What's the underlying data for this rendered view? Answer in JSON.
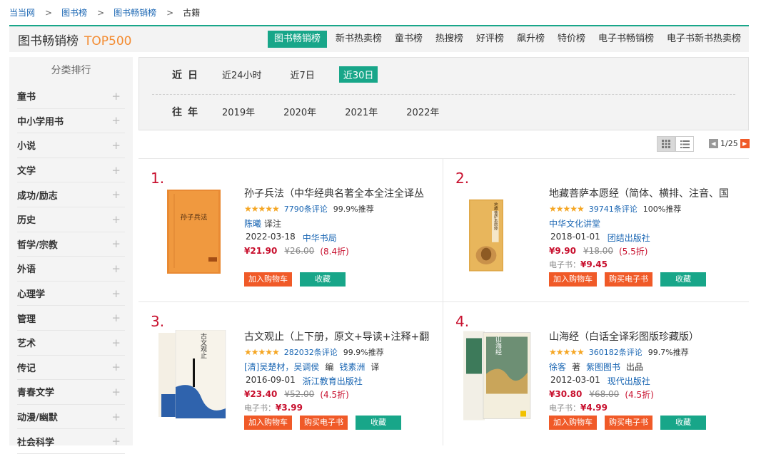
{
  "breadcrumb": [
    "当当网",
    "图书榜",
    "图书畅销榜",
    "古籍"
  ],
  "header": {
    "title": "图书畅销榜",
    "top": "TOP500",
    "tabs": [
      "图书畅销榜",
      "新书热卖榜",
      "童书榜",
      "热搜榜",
      "好评榜",
      "飙升榜",
      "特价榜",
      "电子书畅销榜",
      "电子书新书热卖榜"
    ]
  },
  "sidebar": {
    "title": "分类排行",
    "items": [
      "童书",
      "中小学用书",
      "小说",
      "文学",
      "成功/励志",
      "历史",
      "哲学/宗教",
      "外语",
      "心理学",
      "管理",
      "艺术",
      "传记",
      "青春文学",
      "动漫/幽默",
      "社会科学"
    ]
  },
  "filter": {
    "recent_label": "近日",
    "recent_options": [
      "近24小时",
      "近7日",
      "近30日"
    ],
    "past_label": "往年",
    "past_options": [
      "2019年",
      "2020年",
      "2021年",
      "2022年"
    ]
  },
  "pager": {
    "text": "1/25"
  },
  "products": [
    {
      "rank": "1.",
      "title": "孙子兵法（中华经典名著全本全注全译丛",
      "reviews": "7790条评论",
      "recommend": "99.9%推荐",
      "author": "陈曦",
      "author_role": "译注",
      "date": "2022-03-18",
      "publisher": "中华书局",
      "price": "¥21.90",
      "old_price": "¥26.00",
      "discount": "(8.4折)",
      "ebook_label": "",
      "ebook_price": "",
      "cover_text": "孙子兵法",
      "buttons": [
        "加入购物车",
        "收藏"
      ]
    },
    {
      "rank": "2.",
      "title": "地藏菩萨本愿经（简体、横排、注音、国",
      "reviews": "39741条评论",
      "recommend": "100%推荐",
      "author": "中华文化讲堂",
      "author_role": "",
      "date": "2018-01-01",
      "publisher": "团结出版社",
      "price": "¥9.90",
      "old_price": "¥18.00",
      "discount": "(5.5折)",
      "ebook_label": "电子书：",
      "ebook_price": "¥9.45",
      "cover_text": "地藏菩萨本愿经",
      "buttons": [
        "加入购物车",
        "购买电子书",
        "收藏"
      ]
    },
    {
      "rank": "3.",
      "title": "古文观止（上下册，原文+导读+注释+翻",
      "reviews": "282032条评论",
      "recommend": "99.9%推荐",
      "author": "[清]吴楚材，吴调侯",
      "author_role": "编",
      "author2": "钱素洲",
      "author2_role": "译",
      "date": "2016-09-01",
      "publisher": "浙江教育出版社",
      "price": "¥23.40",
      "old_price": "¥52.00",
      "discount": "(4.5折)",
      "ebook_label": "电子书：",
      "ebook_price": "¥3.99",
      "cover_text": "古文观止",
      "buttons": [
        "加入购物车",
        "购买电子书",
        "收藏"
      ]
    },
    {
      "rank": "4.",
      "title": "山海经（白话全译彩图版珍藏版）",
      "reviews": "360182条评论",
      "recommend": "99.7%推荐",
      "author": "徐客",
      "author_role": "著",
      "author2": "紫图图书",
      "author2_role": "出品",
      "date": "2012-03-01",
      "publisher": "现代出版社",
      "price": "¥30.80",
      "old_price": "¥68.00",
      "discount": "(4.5折)",
      "ebook_label": "电子书：",
      "ebook_price": "¥4.99",
      "cover_text": "山海经",
      "buttons": [
        "加入购物车",
        "购买电子书",
        "收藏"
      ]
    }
  ],
  "colors": {
    "accent": "#18a689",
    "price": "#c8102e",
    "button": "#f05a28",
    "link": "#1a66b3",
    "star": "#f5a623"
  }
}
